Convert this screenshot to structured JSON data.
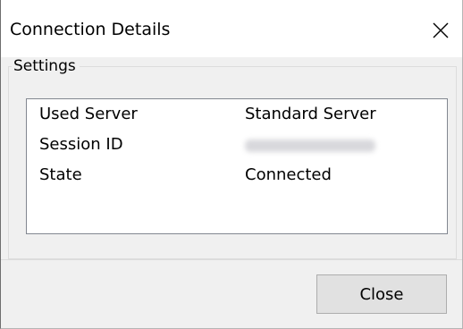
{
  "dialog": {
    "title": "Connection Details",
    "close_icon": "close-x-icon"
  },
  "settings": {
    "group_label": "Settings",
    "rows": [
      {
        "label": "Used Server",
        "value": "Standard Server"
      },
      {
        "label": "Session ID",
        "value": ""
      },
      {
        "label": "State",
        "value": "Connected"
      }
    ]
  },
  "footer": {
    "close_label": "Close"
  }
}
